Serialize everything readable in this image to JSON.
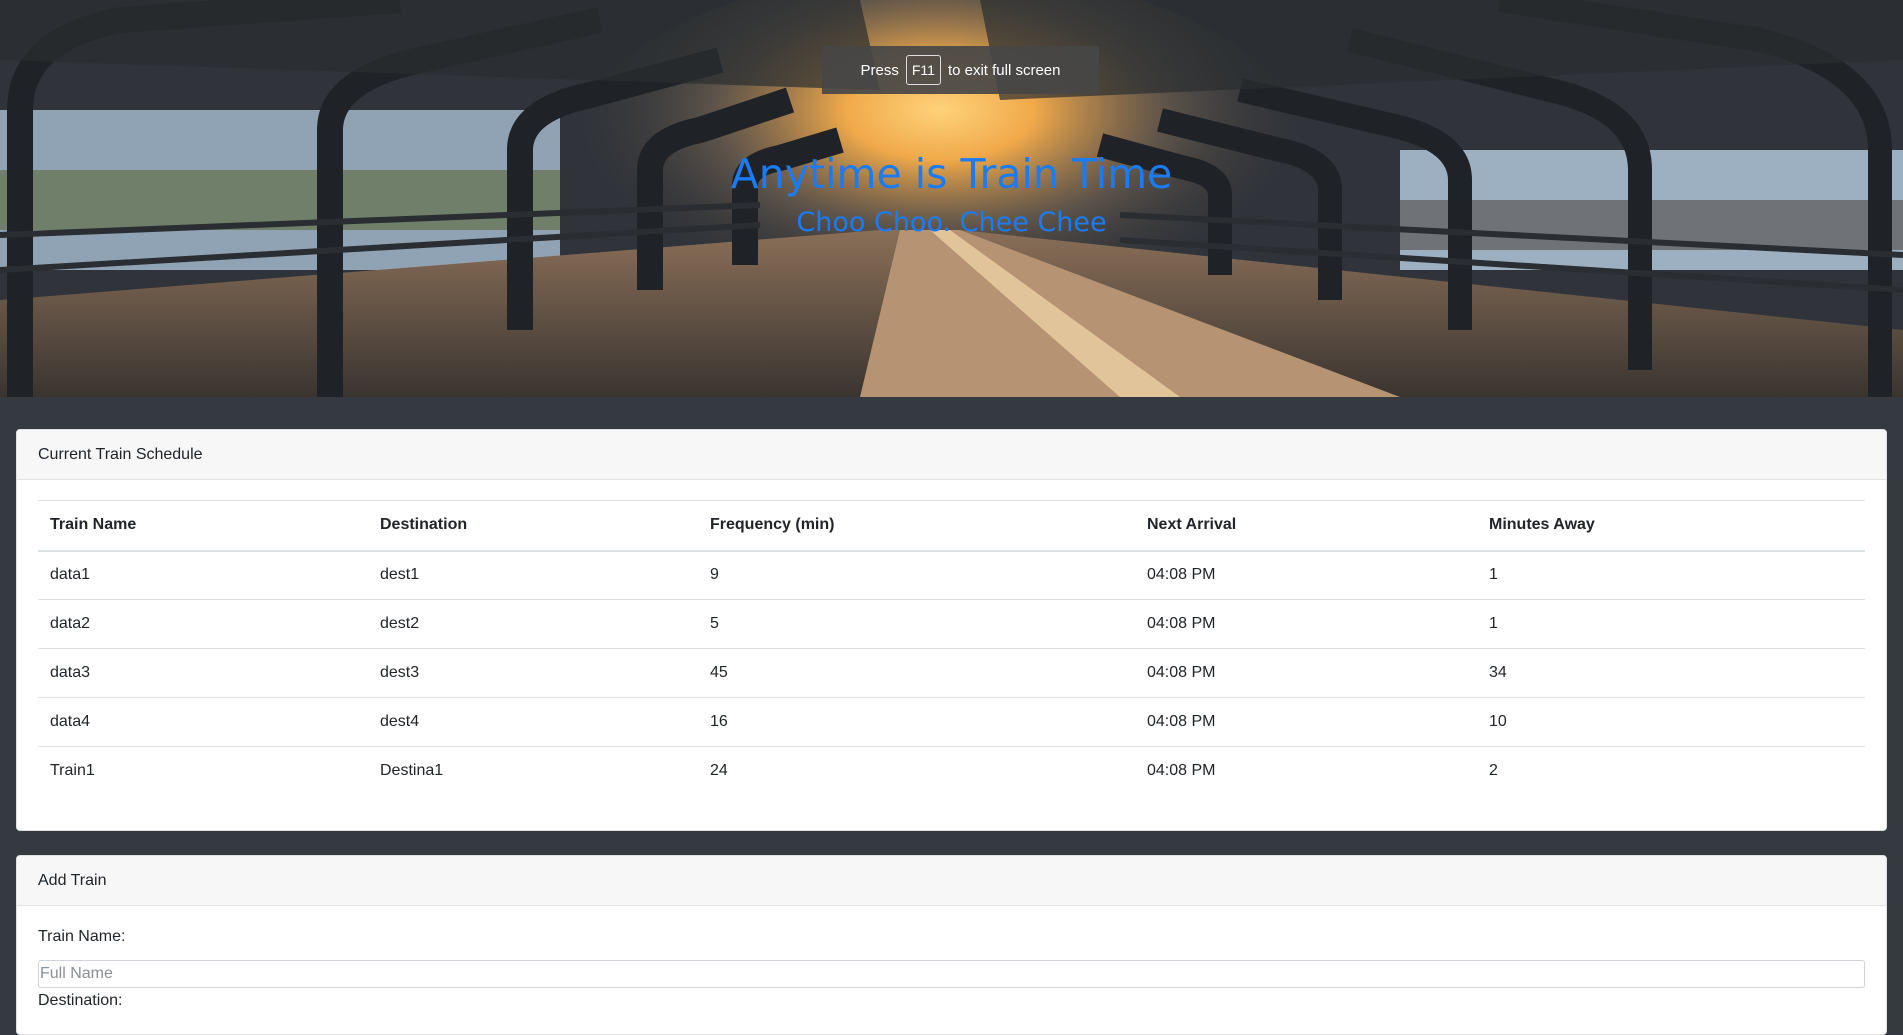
{
  "hero": {
    "title": "Anytime is Train Time",
    "subtitle": "Choo Choo. Chee Chee"
  },
  "fullscreen_toast": {
    "prefix": "Press",
    "key": "F11",
    "suffix": "to exit full screen"
  },
  "schedule": {
    "header": "Current Train Schedule",
    "columns": [
      "Train Name",
      "Destination",
      "Frequency (min)",
      "Next Arrival",
      "Minutes Away"
    ],
    "rows": [
      [
        "data1",
        "dest1",
        "9",
        "04:08 PM",
        "1"
      ],
      [
        "data2",
        "dest2",
        "5",
        "04:08 PM",
        "1"
      ],
      [
        "data3",
        "dest3",
        "45",
        "04:08 PM",
        "34"
      ],
      [
        "data4",
        "dest4",
        "16",
        "04:08 PM",
        "10"
      ],
      [
        "Train1",
        "Destina1",
        "24",
        "04:08 PM",
        "2"
      ]
    ]
  },
  "add_train": {
    "header": "Add Train",
    "train_name_label": "Train Name:",
    "train_name_placeholder": "Full Name",
    "train_name_value": "",
    "destination_label": "Destination:"
  },
  "colors": {
    "accent": "#1a7cf5",
    "page_background": "#343a40"
  }
}
